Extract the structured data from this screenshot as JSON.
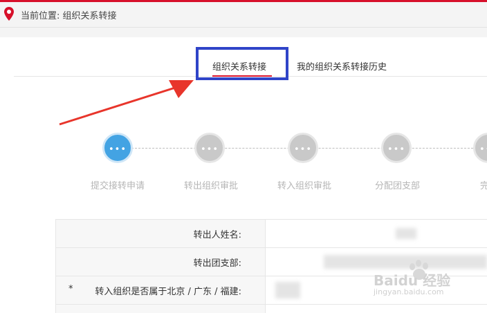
{
  "breadcrumb": {
    "text": "当前位置: 组织关系转接"
  },
  "tabs": [
    {
      "label": "组织关系转接",
      "active": true
    },
    {
      "label": "我的组织关系转接历史",
      "active": false
    }
  ],
  "steps": [
    {
      "label": "提交接转申请",
      "icon": "•••",
      "state": "active"
    },
    {
      "label": "转出组织审批",
      "icon": "•••",
      "state": "pending"
    },
    {
      "label": "转入组织审批",
      "icon": "•••",
      "state": "pending"
    },
    {
      "label": "分配团支部",
      "icon": "•••",
      "state": "pending"
    },
    {
      "label": "完",
      "icon": "•••",
      "state": "pending"
    }
  ],
  "form": {
    "rows": [
      {
        "label": "转出人姓名:",
        "required": false
      },
      {
        "label": "转出团支部:",
        "required": false
      },
      {
        "label": "转入组织是否属于北京 / 广东 / 福建:",
        "required": true,
        "required_mark": "*"
      }
    ]
  },
  "watermark": {
    "brand": "Baidu 经验",
    "url": "jingyan.baidu.com"
  },
  "colors": {
    "accent_red": "#d7102a",
    "step_active": "#43a3e3",
    "highlight_box": "#2f44c8",
    "arrow": "#e8352b"
  }
}
